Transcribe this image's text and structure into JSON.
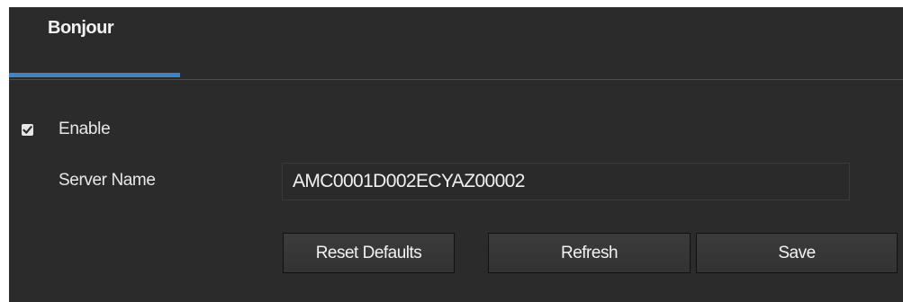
{
  "tabs": [
    {
      "label": "Bonjour",
      "active": true
    }
  ],
  "enable": {
    "label": "Enable",
    "checked": true
  },
  "server_name": {
    "label": "Server Name",
    "value": "AMC0001D002ECYAZ00002"
  },
  "buttons": {
    "reset_defaults": "Reset Defaults",
    "refresh": "Refresh",
    "save": "Save"
  },
  "colors": {
    "panel_background": "#2b2b2b",
    "tab_underline": "#3e84c6",
    "text": "#e8e8e8"
  }
}
